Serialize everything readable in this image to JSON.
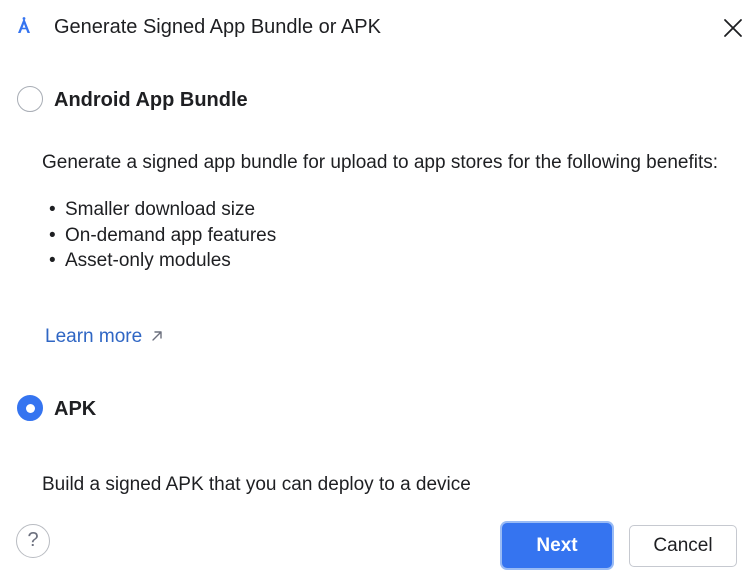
{
  "dialog": {
    "title": "Generate Signed App Bundle or APK",
    "app_icon": "android-studio-icon",
    "close_icon": "close-icon"
  },
  "options": {
    "bundle": {
      "label": "Android App Bundle",
      "selected": false,
      "description": "Generate a signed app bundle for upload to app stores for the following benefits:",
      "benefits": [
        "Smaller download size",
        "On-demand app features",
        "Asset-only modules"
      ],
      "learn_more": "Learn more"
    },
    "apk": {
      "label": "APK",
      "selected": true,
      "description": "Build a signed APK that you can deploy to a device"
    }
  },
  "footer": {
    "help": "?",
    "next_label": "Next",
    "cancel_label": "Cancel"
  },
  "colors": {
    "accent": "#3574f0",
    "link": "#2f66c4",
    "text": "#1e1f22",
    "border": "#c6c9d0"
  }
}
